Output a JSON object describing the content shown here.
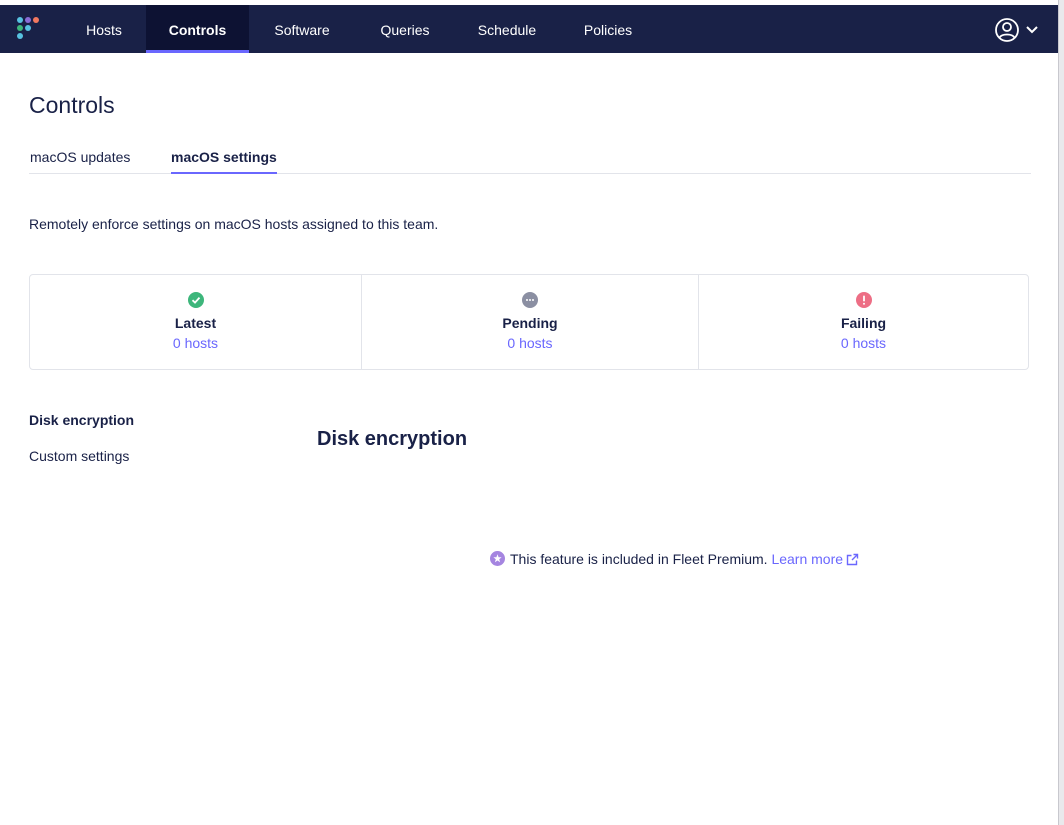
{
  "nav": {
    "items": [
      {
        "label": "Hosts"
      },
      {
        "label": "Controls"
      },
      {
        "label": "Software"
      },
      {
        "label": "Queries"
      },
      {
        "label": "Schedule"
      },
      {
        "label": "Policies"
      }
    ],
    "active": "Controls",
    "user_menu_icon": "user-circle-icon"
  },
  "page": {
    "title": "Controls"
  },
  "tabs": [
    {
      "label": "macOS updates"
    },
    {
      "label": "macOS settings"
    }
  ],
  "active_tab": "macOS settings",
  "description": "Remotely enforce settings on macOS hosts assigned to this team.",
  "summary": [
    {
      "label": "Latest",
      "count": "0 hosts",
      "icon": "check-circle-icon",
      "color": "#3db67b"
    },
    {
      "label": "Pending",
      "count": "0 hosts",
      "icon": "pending-icon",
      "color": "#8b8fa2"
    },
    {
      "label": "Failing",
      "count": "0 hosts",
      "icon": "error-icon",
      "color": "#ed6e85"
    }
  ],
  "side_nav": [
    {
      "label": "Disk encryption"
    },
    {
      "label": "Custom settings"
    }
  ],
  "side_nav_active": "Disk encryption",
  "section": {
    "title": "Disk encryption",
    "premium_message": "This feature is included in Fleet Premium.",
    "learn_more": "Learn more"
  },
  "colors": {
    "navbar": "#192147",
    "accent": "#6a67fe",
    "text": "#192147",
    "border": "#e2e4ea"
  }
}
